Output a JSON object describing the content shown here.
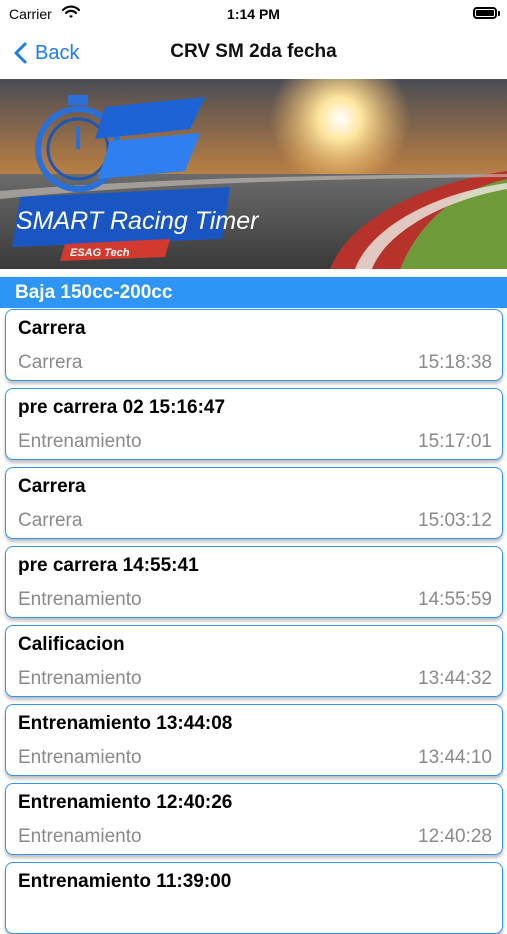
{
  "status_bar": {
    "carrier": "Carrier",
    "time": "1:14 PM"
  },
  "nav": {
    "back_label": "Back",
    "title": "CRV SM 2da fecha"
  },
  "banner": {
    "logo_text": "SMART Racing Timer",
    "logo_sub": "ESAG Tech"
  },
  "section": {
    "title": "Baja 150cc-200cc"
  },
  "sessions": [
    {
      "title": "Carrera",
      "type": "Carrera",
      "time": "15:18:38"
    },
    {
      "title": "pre carrera 02 15:16:47",
      "type": "Entrenamiento",
      "time": "15:17:01"
    },
    {
      "title": "Carrera",
      "type": "Carrera",
      "time": "15:03:12"
    },
    {
      "title": "pre carrera 14:55:41",
      "type": "Entrenamiento",
      "time": "14:55:59"
    },
    {
      "title": "Calificacion",
      "type": "Entrenamiento",
      "time": "13:44:32"
    },
    {
      "title": "Entrenamiento 13:44:08",
      "type": "Entrenamiento",
      "time": "13:44:10"
    },
    {
      "title": "Entrenamiento 12:40:26",
      "type": "Entrenamiento",
      "time": "12:40:28"
    },
    {
      "title": "Entrenamiento 11:39:00",
      "type": "",
      "time": ""
    }
  ]
}
